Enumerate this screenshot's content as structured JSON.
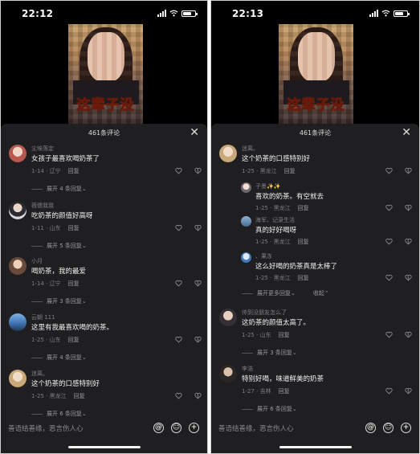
{
  "left": {
    "time": "22:12",
    "comment_count": "461条评论",
    "video_caption": "这辈子没",
    "comments": [
      {
        "user": "尘埃落定",
        "text": "女孩子最喜欢喝奶茶了",
        "date": "1-14",
        "location": "辽宁",
        "reply": "回复",
        "expand": "展开 4 条回复"
      },
      {
        "user": "薇儒我我",
        "text": "吃奶茶的颜值好高呀",
        "date": "1-11",
        "location": "山东",
        "reply": "回复",
        "expand": "展开 5 条回复"
      },
      {
        "user": "小月",
        "text": "喝奶茶，我的最爱",
        "date": "1-14",
        "location": "辽宁",
        "reply": "回复",
        "expand": "展开 3 条回复"
      },
      {
        "user": "云朝 111",
        "text": "这里有我最喜欢喝的奶茶。",
        "date": "1-25",
        "location": "山东",
        "reply": "回复",
        "expand": "展开 4 条回复"
      },
      {
        "user": "迷离。",
        "text": "这个奶茶的口感特别好",
        "date": "1-25",
        "location": "黑龙江",
        "reply": "回复",
        "expand": "展开 6 条回复"
      }
    ],
    "input_placeholder": "善语结善缘，恶言伤人心"
  },
  "right": {
    "time": "22:13",
    "comment_count": "461条评论",
    "video_caption": "这辈子没",
    "comments": [
      {
        "user": "迷离。",
        "text": "这个奶茶的口感特别好",
        "date": "1-25",
        "location": "黑龙江",
        "reply": "回复"
      },
      {
        "user": "子墨✨✨",
        "text": "喜欢的奶茶。有空就去",
        "date": "1-25",
        "location": "黑龙江",
        "reply": "回复"
      },
      {
        "user": "海军、记录生活",
        "text": "真的好好喝呀",
        "date": "1-25",
        "location": "黑龙江",
        "reply": "回复"
      },
      {
        "user": "、果冻",
        "text": "这么好喝的奶茶真是太棒了",
        "date": "1-25",
        "location": "黑龙江",
        "reply": "回复"
      },
      {
        "user": "帅到没朋友怎么了",
        "text": "这奶茶的颜值太高了。",
        "date": "1-25",
        "location": "山东",
        "reply": "回复",
        "expand": "展开 3 条回复"
      },
      {
        "user": "李浩",
        "text": "特别好喝，味道鲜美的奶茶",
        "date": "1-27",
        "location": "吉林",
        "reply": "回复",
        "expand": "展开 6 条回复"
      }
    ],
    "expand_more": "展开更多回复",
    "collapse": "收起",
    "input_placeholder": "善语结善缘，恶言伤人心"
  },
  "icons": {
    "heart": "heart-icon",
    "dislike": "dislike-icon",
    "at": "at-icon",
    "emoji": "emoji-icon",
    "add": "add-icon"
  }
}
